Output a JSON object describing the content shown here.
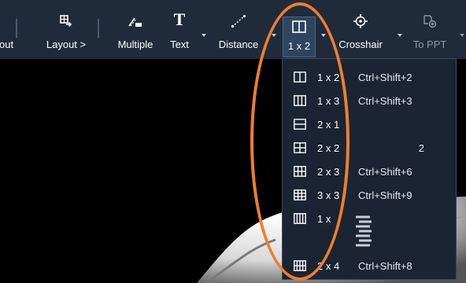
{
  "colors": {
    "toolbar_bg": "#1f2b3b",
    "menu_bg": "#1a2433",
    "highlight_oval": "#ef7d2e",
    "text": "#ffffff"
  },
  "toolbar": {
    "partial_label": "out",
    "layout": {
      "label": "Layout >",
      "icon": "layout-export-icon"
    },
    "multiple": {
      "label": "Multiple",
      "icon": "multiple-annotation-icon"
    },
    "text": {
      "label": "Text",
      "icon": "text-icon"
    },
    "distance": {
      "label": "Distance",
      "icon": "distance-ruler-icon"
    },
    "split": {
      "label": "1 x 2",
      "icon": "split-1x2-icon"
    },
    "crosshair": {
      "label": "Crosshair",
      "icon": "crosshair-icon"
    },
    "to_ppt": {
      "label": "To PPT",
      "icon": "export-ppt-icon"
    }
  },
  "split_menu": {
    "items": [
      {
        "label": "1 x 2",
        "shortcut": "Ctrl+Shift+2",
        "icon": "grid-1x2-icon"
      },
      {
        "label": "1 x 3",
        "shortcut": "Ctrl+Shift+3",
        "icon": "grid-1x3-icon"
      },
      {
        "label": "2 x 1",
        "shortcut": "",
        "icon": "grid-2x1-icon"
      },
      {
        "label": "2 x 2",
        "shortcut": "2",
        "icon": "grid-2x2-icon"
      },
      {
        "label": "2 x 3",
        "shortcut": "Ctrl+Shift+6",
        "icon": "grid-2x3-icon"
      },
      {
        "label": "3 x 3",
        "shortcut": "Ctrl+Shift+9",
        "icon": "grid-3x3-icon"
      },
      {
        "label": "1 x",
        "shortcut": "",
        "icon": "grid-1x4-icon"
      },
      {
        "label": "2 x 4",
        "shortcut": "Ctrl+Shift+8",
        "icon": "grid-2x4-icon"
      }
    ]
  }
}
